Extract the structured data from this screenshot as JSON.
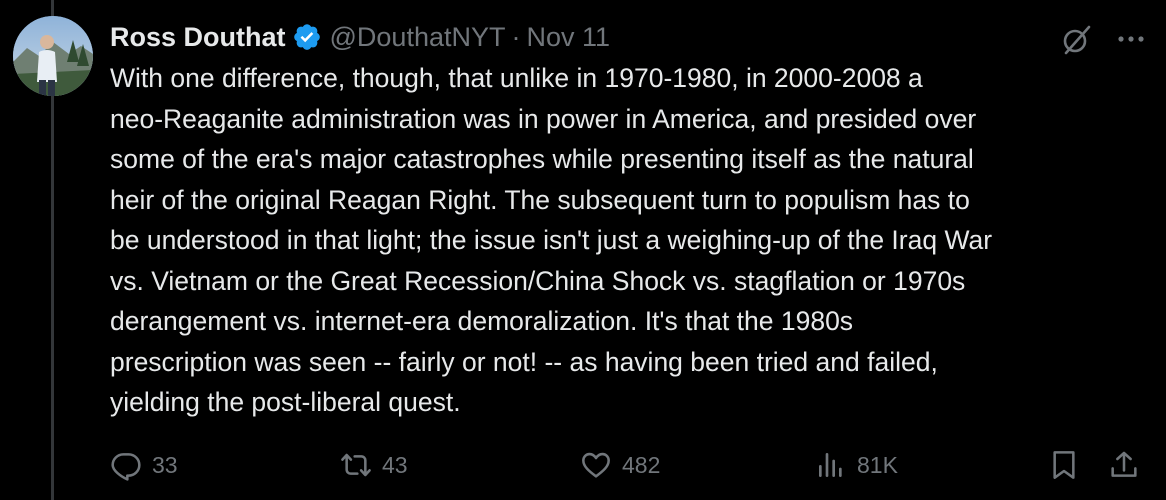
{
  "author": {
    "display_name": "Ross Douthat",
    "handle": "@DouthatNYT",
    "separator": "·",
    "date": "Nov 11",
    "verified_icon": "verified-badge-icon",
    "verified_color": "#1d9bf0"
  },
  "header_actions": {
    "grok_icon": "grok-icon",
    "more_icon": "more-icon"
  },
  "tweet": {
    "text": "With one difference, though, that unlike in 1970-1980, in 2000-2008 a\nneo-Reaganite administration was in power in America, and presided over\nsome of the era's major catastrophes while presenting itself as the natural\nheir of the original Reagan Right. The subsequent turn to populism has to\nbe understood in that light; the issue isn't just a weighing-up of the Iraq War\nvs. Vietnam or the Great Recession/China Shock vs. stagflation or 1970s\nderangement vs. internet-era demoralization. It's that the 1980s\nprescription was seen -- fairly or not! -- as having been tried and failed,\nyielding the post-liberal quest."
  },
  "actions": {
    "reply_count": "33",
    "retweet_count": "43",
    "like_count": "482",
    "views_count": "81K"
  },
  "colors": {
    "background": "#000000",
    "text": "#e7e9ea",
    "muted": "#71767b",
    "accent": "#1d9bf0"
  }
}
